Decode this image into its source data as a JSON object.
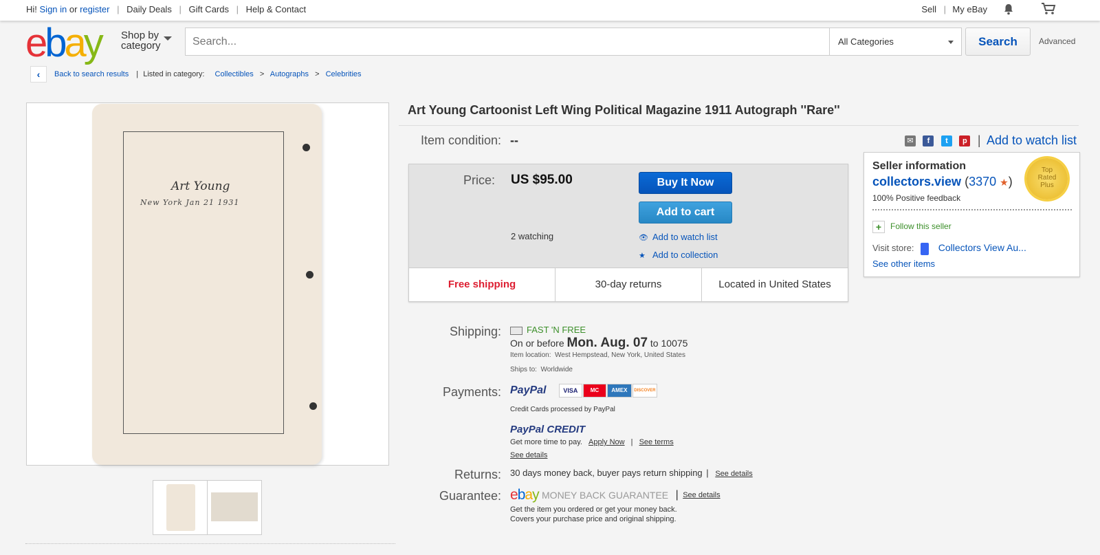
{
  "topbar": {
    "greeting": "Hi!",
    "sign_in": "Sign in",
    "or": "or",
    "register": "register",
    "daily_deals": "Daily Deals",
    "gift_cards": "Gift Cards",
    "help": "Help & Contact",
    "sell": "Sell",
    "my_ebay": "My eBay",
    "bell_icon": "bell-icon",
    "cart_icon": "cart-icon"
  },
  "header": {
    "logo_letters": [
      "e",
      "b",
      "a",
      "y"
    ],
    "logo_colors": [
      "#e53238",
      "#0064d2",
      "#f5af02",
      "#86b817"
    ],
    "shop_by_line1": "Shop by",
    "shop_by_line2": "category",
    "search_placeholder": "Search...",
    "category_selected": "All Categories",
    "search_button": "Search",
    "advanced": "Advanced"
  },
  "breadcrumb": {
    "back": "Back to search results",
    "listed_in": "Listed in category:",
    "items": [
      "Collectibles",
      "Autographs",
      "Celebrities"
    ],
    "separator": ">"
  },
  "gallery": {
    "signature_line1": "Art Young",
    "signature_line2": "New York Jan 21 1931"
  },
  "item": {
    "title": "Art Young Cartoonist Left Wing Political Magazine 1911 Autograph ''Rare''",
    "condition_label": "Item condition:",
    "condition_value": "--",
    "add_to_watch_list": "Add to watch list",
    "share_separator": "|"
  },
  "pricebox": {
    "price_label": "Price:",
    "price": "US $95.00",
    "buy_it_now": "Buy It Now",
    "add_to_cart": "Add to cart",
    "watching": "2 watching",
    "add_to_watch_list": "Add to watch list",
    "add_to_collection": "Add to collection",
    "free_shipping": "Free shipping",
    "returns": "30-day returns",
    "location": "Located in United States"
  },
  "seller": {
    "heading": "Seller information",
    "name": "collectors.view",
    "score": "3370",
    "feedback": "100% Positive feedback",
    "badge_line1": "Top",
    "badge_line2": "Rated",
    "badge_line3": "Plus",
    "follow": "Follow this seller",
    "visit_store": "Visit store:",
    "store_name": "Collectors View Au...",
    "see_other": "See other items"
  },
  "shipping": {
    "label": "Shipping:",
    "fast_free": "FAST 'N FREE",
    "on_or_before": "On or before",
    "date": "Mon. Aug. 07",
    "to": "to",
    "zip": "10075",
    "location_label": "Item location:",
    "location_value": "West Hempstead, New York, United States",
    "ships_to_label": "Ships to:",
    "ships_to_value": "Worldwide"
  },
  "payments": {
    "label": "Payments:",
    "paypal": "PayPal",
    "cards": [
      "VISA",
      "MC",
      "AMEX",
      "DISCOVER"
    ],
    "card_colors": [
      "#1a1f71",
      "#eb001b",
      "#2e77bb",
      "#f58220"
    ],
    "processed": "Credit Cards processed by PayPal",
    "paypal_credit": "PayPal CREDIT",
    "more_time": "Get more time to pay.",
    "apply_now": "Apply Now",
    "see_terms": "See terms",
    "see_details": "See details"
  },
  "returns": {
    "label": "Returns:",
    "text": "30 days money back, buyer pays return shipping",
    "see_details": "See details"
  },
  "guarantee": {
    "label": "Guarantee:",
    "mbg": "MONEY BACK GUARANTEE",
    "see_details": "See details",
    "line1": "Get the item you ordered or get your money back.",
    "line2": "Covers your purchase price and original shipping."
  }
}
